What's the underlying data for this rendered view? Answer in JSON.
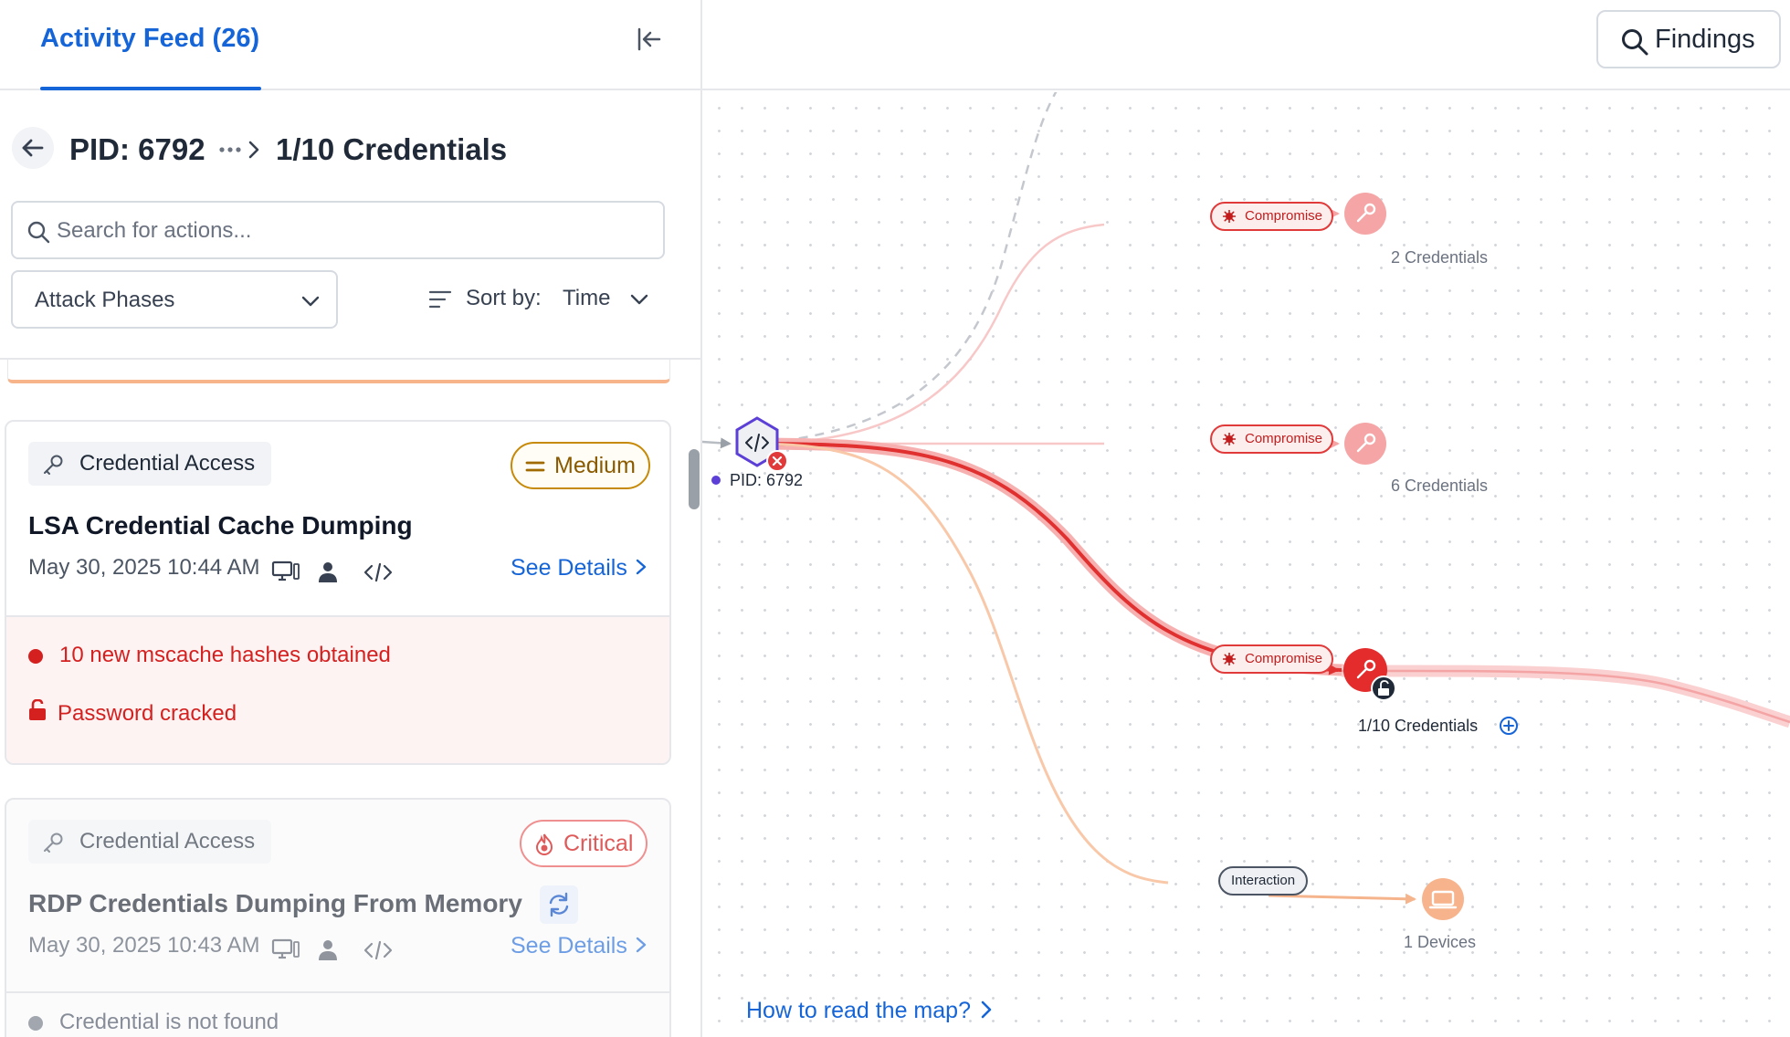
{
  "header": {
    "tab_label": "Activity Feed (26)"
  },
  "breadcrumb": {
    "pid": "PID: 6792",
    "current": "1/10 Credentials"
  },
  "search": {
    "placeholder": "Search for actions..."
  },
  "filters": {
    "phases_label": "Attack Phases",
    "sort_label": "Sort by:",
    "sort_value": "Time"
  },
  "cards": [
    {
      "category": "Credential Access",
      "severity": "Medium",
      "title": "LSA Credential Cache Dumping",
      "timestamp": "May 30, 2025 10:44 AM",
      "details_label": "See Details",
      "findings": [
        "10 new mscache hashes obtained",
        "Password cracked"
      ]
    },
    {
      "category": "Credential Access",
      "severity": "Critical",
      "title": "RDP Credentials Dumping From Memory",
      "timestamp": "May 30, 2025 10:43 AM",
      "details_label": "See Details",
      "findings": [
        "Credential is not found"
      ]
    }
  ],
  "map": {
    "findings_button": "Findings",
    "source_node": "PID: 6792",
    "edges": [
      "Compromise",
      "Compromise",
      "Compromise",
      "Interaction"
    ],
    "targets": [
      "2 Credentials",
      "6 Credentials",
      "1/10 Credentials",
      "1 Devices"
    ],
    "help_link": "How to read the map?"
  },
  "colors": {
    "accent": "#1565d8",
    "danger": "#d52020",
    "medium": "#c68a08",
    "critical": "#f08f8f",
    "device": "#f5b48c",
    "source": "#5b3fd6"
  }
}
